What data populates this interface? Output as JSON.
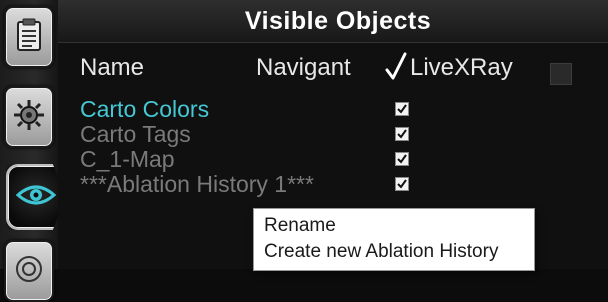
{
  "panel": {
    "title": "Visible Objects"
  },
  "columns": {
    "name": "Name",
    "navigant": "Navigant",
    "live_xray": "LiveXRay"
  },
  "objects": [
    {
      "name": "Carto Colors",
      "color": "#46c8d4",
      "navigant_checked": true
    },
    {
      "name": "Carto Tags",
      "color": "#7a7a7a",
      "navigant_checked": true
    },
    {
      "name": "C_1-Map",
      "color": "#7a7a7a",
      "navigant_checked": true
    },
    {
      "name": "***Ablation History 1***",
      "color": "#7a7a7a",
      "navigant_checked": true
    }
  ],
  "context_menu": {
    "items": [
      "Rename",
      "Create new Ablation History"
    ]
  },
  "toolbar": {
    "icons": [
      "clipboard-icon",
      "radiation-gear-icon",
      "eye-icon",
      "target-icon"
    ]
  },
  "colors": {
    "accent_cyan": "#46c8d4",
    "dim_text": "#7a7a7a"
  }
}
